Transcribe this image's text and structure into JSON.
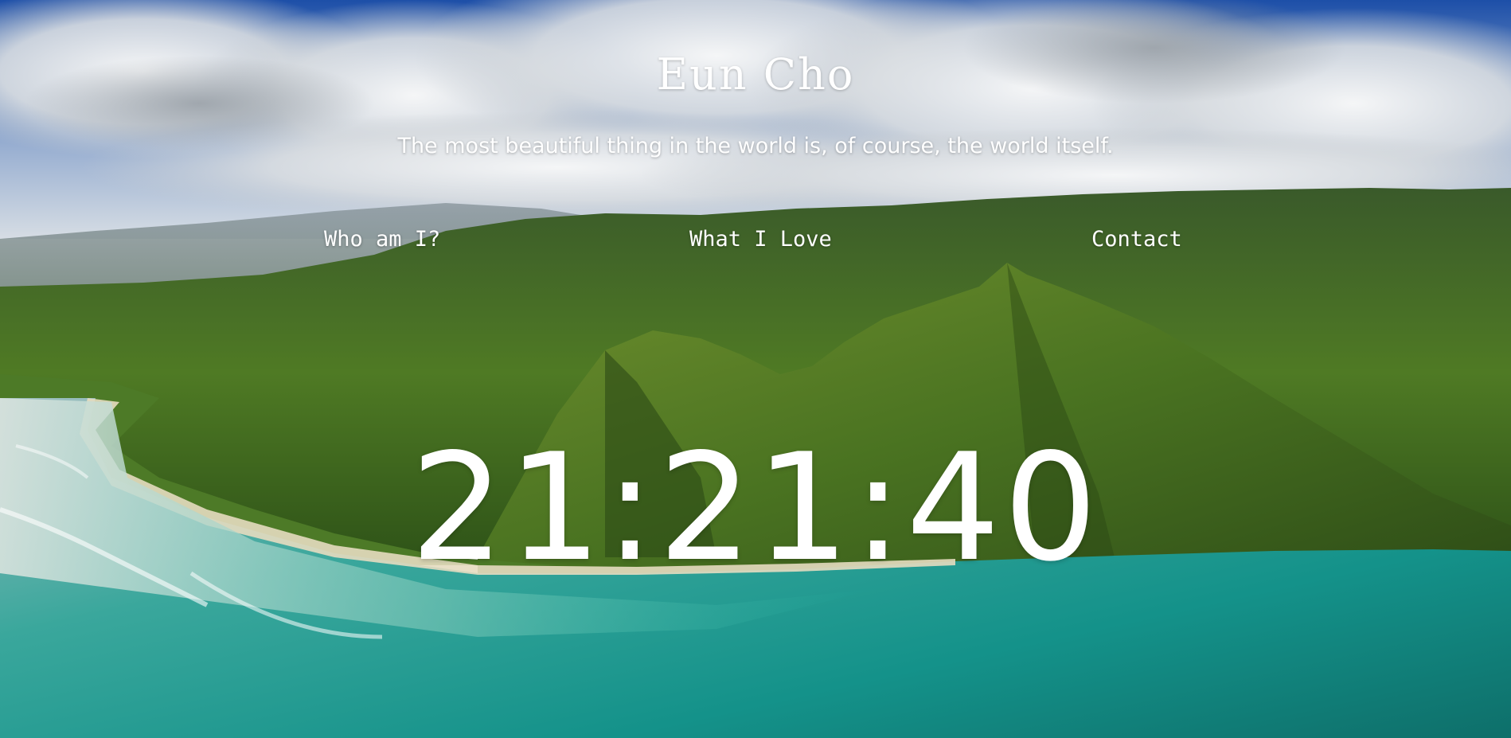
{
  "header": {
    "title": "Eun Cho",
    "tagline": "The most beautiful thing in the world is, of course, the world itself."
  },
  "nav": {
    "items": [
      {
        "label": "Who am I?"
      },
      {
        "label": "What I Love"
      },
      {
        "label": "Contact"
      }
    ]
  },
  "clock": {
    "time": "21:21:40"
  },
  "background": {
    "subject": "aerial-mountain-coast-photo",
    "colors": {
      "sky": "#1d4fa8",
      "cloud": "#e8ecef",
      "mountain": "#3f6a22",
      "sea": "#1aa396",
      "sand": "#e6dcc0"
    }
  }
}
